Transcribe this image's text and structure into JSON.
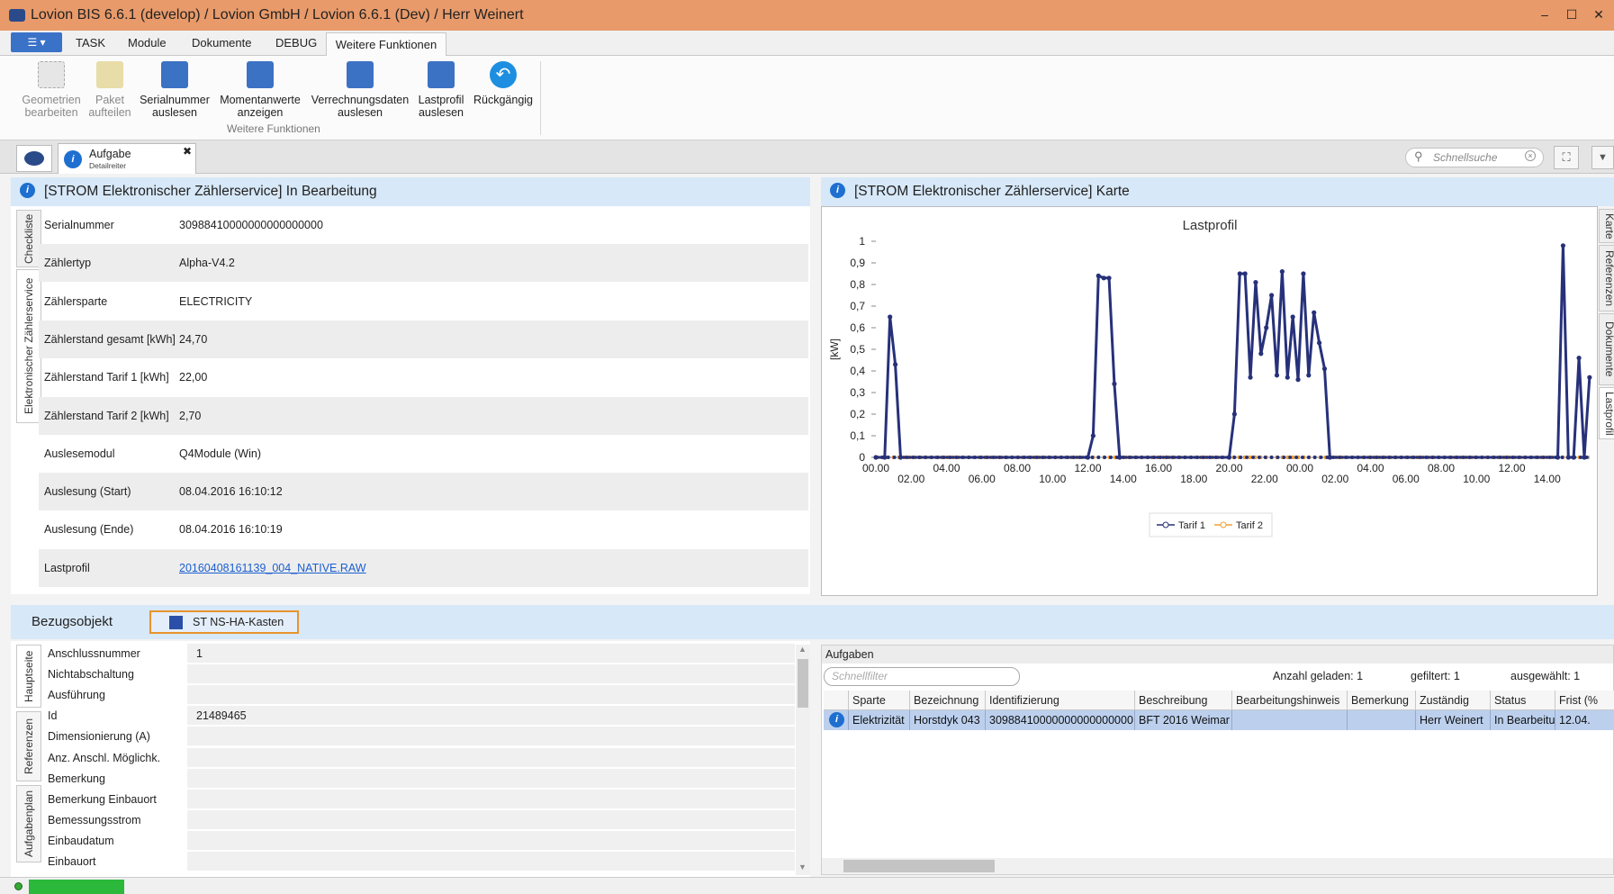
{
  "window": {
    "title": "Lovion BIS 6.6.1 (develop) / Lovion GmbH / Lovion 6.6.1 (Dev) / Herr Weinert",
    "minimize": "–",
    "maximize": "☐",
    "close": "✕"
  },
  "menu": {
    "app_button": "☰ ▾",
    "tabs": [
      "TASK",
      "Module",
      "Dokumente",
      "DEBUG"
    ],
    "active_tab": "Weitere Funktionen"
  },
  "ribbon": {
    "buttons": [
      {
        "label1": "Geometrien",
        "label2": "bearbeiten"
      },
      {
        "label1": "Paket",
        "label2": "aufteilen"
      },
      {
        "label1": "Serialnummer",
        "label2": "auslesen"
      },
      {
        "label1": "Momentanwerte",
        "label2": "anzeigen"
      },
      {
        "label1": "Verrechnungsdaten",
        "label2": "auslesen"
      },
      {
        "label1": "Lastprofil",
        "label2": "auslesen"
      },
      {
        "label1": "Rückgängig",
        "label2": ""
      }
    ],
    "group_label": "Weitere Funktionen"
  },
  "doc_tab": {
    "title": "Aufgabe",
    "subtitle": "Detailreiter",
    "close": "✖"
  },
  "search": {
    "placeholder": "Schnellsuche"
  },
  "left_panel": {
    "header": "[STROM Elektronischer Zählerservice] In Bearbeitung",
    "side_tabs": [
      "Checkliste",
      "Elektronischer Zählerservice"
    ],
    "fields": [
      {
        "label": "Serialnummer",
        "value": "30988410000000000000000"
      },
      {
        "label": "Zählertyp",
        "value": "Alpha-V4.2"
      },
      {
        "label": "Zählersparte",
        "value": "ELECTRICITY"
      },
      {
        "label": "Zählerstand gesamt [kWh]",
        "value": "24,70"
      },
      {
        "label": "Zählerstand Tarif 1 [kWh]",
        "value": "22,00"
      },
      {
        "label": "Zählerstand Tarif 2 [kWh]",
        "value": "2,70"
      },
      {
        "label": "Auslesemodul",
        "value": "Q4Module (Win)"
      },
      {
        "label": "Auslesung (Start)",
        "value": "08.04.2016 16:10:12"
      },
      {
        "label": "Auslesung (Ende)",
        "value": "08.04.2016 16:10:19"
      },
      {
        "label": "Lastprofil",
        "value": "20160408161139_004_NATIVE.RAW"
      }
    ]
  },
  "right_panel": {
    "header": "[STROM Elektronischer Zählerservice] Karte",
    "side_tabs": [
      "Karte",
      "Referenzen",
      "Dokumente",
      "Lastprofil"
    ]
  },
  "chart_data": {
    "type": "line",
    "title": "Lastprofil",
    "ylabel": "[kW]",
    "xlabel": "",
    "ylim": [
      0,
      1
    ],
    "yticks": [
      "0",
      "0,1",
      "0,2",
      "0,3",
      "0,4",
      "0,5",
      "0,6",
      "0,7",
      "0,8",
      "0,9",
      "1"
    ],
    "xticks_upper": [
      "00.00",
      "04.00",
      "08.00",
      "12.00",
      "16.00",
      "20.00",
      "00.00",
      "04.00",
      "08.00",
      "12.00"
    ],
    "xticks_lower": [
      "02.00",
      "06.00",
      "10.00",
      "14.00",
      "18.00",
      "22.00",
      "02.00",
      "06.00",
      "10.00",
      "14.00"
    ],
    "x_hours_range": [
      0,
      40
    ],
    "legend": "bottom",
    "series": [
      {
        "name": "Tarif 1",
        "color": "#27317a",
        "points": [
          [
            0,
            0
          ],
          [
            0.5,
            0
          ],
          [
            0.8,
            0.65
          ],
          [
            1.1,
            0.43
          ],
          [
            1.4,
            0
          ],
          [
            12,
            0
          ],
          [
            12.3,
            0.1
          ],
          [
            12.6,
            0.84
          ],
          [
            12.9,
            0.83
          ],
          [
            13.2,
            0.83
          ],
          [
            13.5,
            0.34
          ],
          [
            13.8,
            0
          ],
          [
            20,
            0
          ],
          [
            20.3,
            0.2
          ],
          [
            20.6,
            0.85
          ],
          [
            20.9,
            0.85
          ],
          [
            21.2,
            0.37
          ],
          [
            21.5,
            0.81
          ],
          [
            21.8,
            0.48
          ],
          [
            22.1,
            0.6
          ],
          [
            22.4,
            0.75
          ],
          [
            22.7,
            0.38
          ],
          [
            23.0,
            0.86
          ],
          [
            23.3,
            0.37
          ],
          [
            23.6,
            0.65
          ],
          [
            23.9,
            0.36
          ],
          [
            24.2,
            0.85
          ],
          [
            24.5,
            0.38
          ],
          [
            24.8,
            0.67
          ],
          [
            25.1,
            0.53
          ],
          [
            25.4,
            0.41
          ],
          [
            25.7,
            0
          ],
          [
            38.6,
            0
          ],
          [
            38.9,
            0.98
          ],
          [
            39.2,
            0
          ],
          [
            39.5,
            0
          ],
          [
            39.8,
            0.46
          ],
          [
            40.1,
            0
          ],
          [
            40.4,
            0.37
          ]
        ]
      },
      {
        "name": "Tarif 2",
        "color": "#f0a030",
        "points": [
          [
            0,
            0
          ],
          [
            40.4,
            0
          ]
        ]
      }
    ]
  },
  "bezug": {
    "title": "Bezugsobjekt",
    "button": "ST NS-HA-Kasten",
    "side_tabs": [
      "Hauptseite",
      "Referenzen",
      "Aufgabenplan"
    ],
    "rows": [
      {
        "label": "Anschlussnummer",
        "value": "1"
      },
      {
        "label": "Nichtabschaltung",
        "value": ""
      },
      {
        "label": "Ausführung",
        "value": ""
      },
      {
        "label": "Id",
        "value": "21489465"
      },
      {
        "label": "Dimensionierung (A)",
        "value": ""
      },
      {
        "label": "Anz. Anschl. Möglichk.",
        "value": ""
      },
      {
        "label": "Bemerkung",
        "value": ""
      },
      {
        "label": "Bemerkung Einbauort",
        "value": ""
      },
      {
        "label": "Bemessungsstrom",
        "value": ""
      },
      {
        "label": "Einbaudatum",
        "value": ""
      },
      {
        "label": "Einbauort",
        "value": ""
      }
    ]
  },
  "tasks": {
    "title": "Aufgaben",
    "filter_placeholder": "Schnellfilter",
    "loaded": "Anzahl geladen: 1",
    "filtered": "gefiltert: 1",
    "selected": "ausgewählt: 1",
    "columns": [
      "Sparte",
      "Bezeichnung",
      "Identifizierung",
      "Beschreibung",
      "Bearbeitungshinweis",
      "Bemerkung",
      "Zuständig",
      "Status",
      "Frist (%"
    ],
    "row": [
      "Elektrizität",
      "Horstdyk 043",
      "30988410000000000000000",
      "BFT 2016 Weimar",
      "",
      "",
      "Herr Weinert",
      "In Bearbeitung",
      "12.04."
    ]
  },
  "colors": {
    "accent": "#e89a6a",
    "header": "#d7e8f8",
    "series1": "#27317a",
    "series2": "#f0a030"
  }
}
